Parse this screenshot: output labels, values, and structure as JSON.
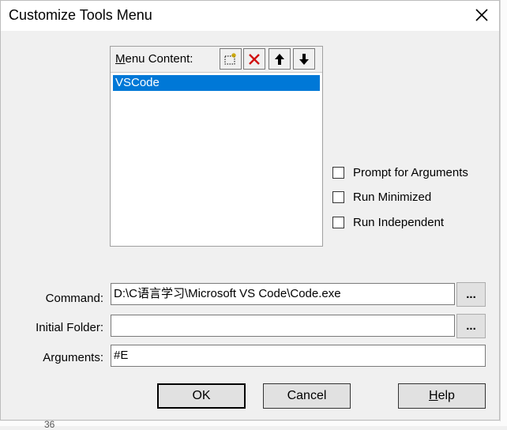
{
  "window": {
    "title": "Customize Tools Menu"
  },
  "menu": {
    "label_prefix": "",
    "label_mnemonic": "M",
    "label_rest": "enu Content:",
    "items": [
      {
        "label": "VSCode",
        "selected": true
      }
    ],
    "toolbar": {
      "new_icon": "new-item-icon",
      "delete_icon": "delete-x-icon",
      "up_icon": "arrow-up-icon",
      "down_icon": "arrow-down-icon"
    }
  },
  "options": {
    "prompt_args": {
      "label": "Prompt for  Arguments",
      "checked": false
    },
    "run_minimized": {
      "label": "Run Minimized",
      "checked": false
    },
    "run_independent": {
      "label": "Run Independent",
      "checked": false
    }
  },
  "fields": {
    "command": {
      "label": "Command:",
      "value": "D:\\C语言学习\\Microsoft VS Code\\Code.exe"
    },
    "initial_folder": {
      "label": "Initial Folder:",
      "value": ""
    },
    "arguments": {
      "label": "Arguments:",
      "value": "#E"
    },
    "browse_label": "..."
  },
  "buttons": {
    "ok": "OK",
    "cancel": "Cancel",
    "help_mnemonic": "H",
    "help_rest": "elp"
  },
  "background": {
    "bottom_text": "36"
  },
  "colors": {
    "selection": "#0078d7",
    "dialog_bg": "#f0f0f0"
  }
}
